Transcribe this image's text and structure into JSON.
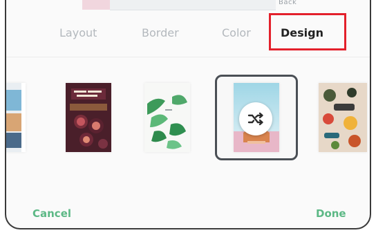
{
  "top_strip": {
    "label": "Back"
  },
  "tabs": [
    {
      "label": "Layout"
    },
    {
      "label": "Border"
    },
    {
      "label": "Color"
    },
    {
      "label": "Design",
      "active": true
    }
  ],
  "designs": [
    {
      "name": "partial-design-thumbnail"
    },
    {
      "name": "figs-design-thumbnail"
    },
    {
      "name": "green-leaves-design-thumbnail"
    },
    {
      "name": "current-design-thumbnail",
      "selected": true
    },
    {
      "name": "fruits-design-thumbnail"
    }
  ],
  "shuffle": {
    "icon": "shuffle-icon"
  },
  "footer": {
    "cancel_label": "Cancel",
    "done_label": "Done"
  },
  "colors": {
    "accent": "#5cb885",
    "highlight": "#e3202b",
    "selected_border": "#4a4f55"
  }
}
